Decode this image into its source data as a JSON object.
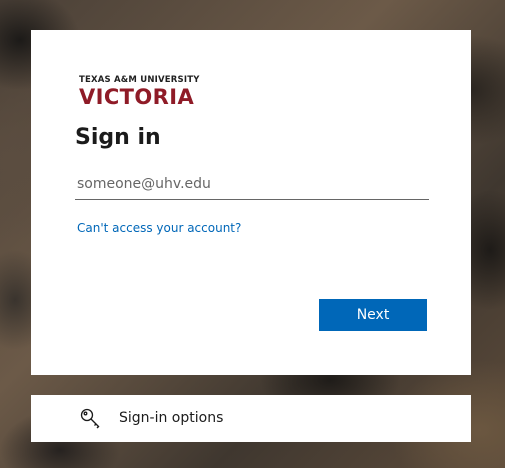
{
  "logo": {
    "university_line": "TEXAS A&M UNIVERSITY",
    "campus_name": "VICTORIA",
    "brand_color": "#8f1b27"
  },
  "signin": {
    "title": "Sign in",
    "email_placeholder": "someone@uhv.edu",
    "email_value": "",
    "cant_access_link": "Can't access your account?",
    "next_button": "Next",
    "accent_color": "#0067b8"
  },
  "signin_options": {
    "label": "Sign-in options",
    "icon": "key-icon"
  }
}
